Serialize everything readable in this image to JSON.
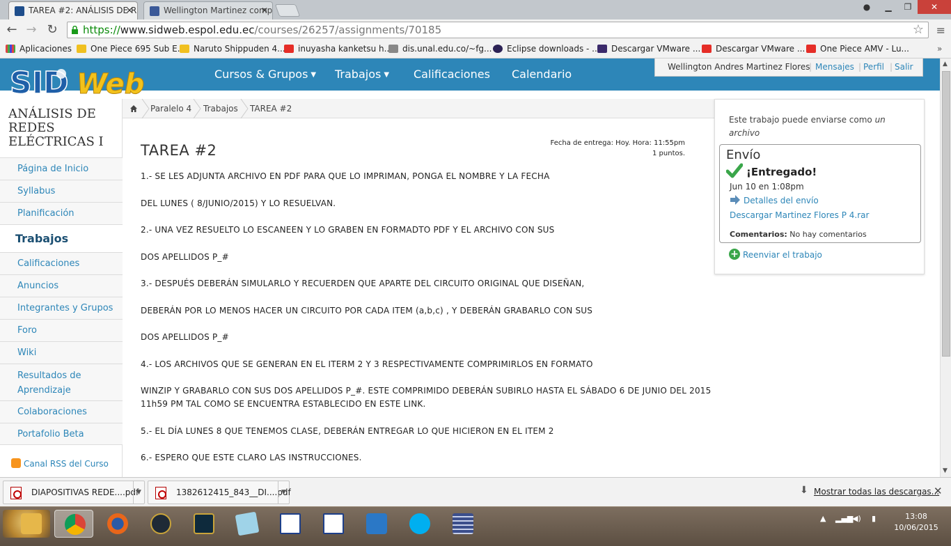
{
  "browser": {
    "tabs": [
      {
        "title": "TAREA #2: ANÁLISIS DE RE",
        "active": true
      },
      {
        "title": "Wellington Martinez comp",
        "active": false
      }
    ],
    "url": {
      "scheme": "https://",
      "host": "www.sidweb.espol.edu.ec",
      "path": "/courses/26257/assignments/70185"
    },
    "bookmarks": [
      {
        "label": "Aplicaciones",
        "icon": "apps-grid-icon"
      },
      {
        "label": "One Piece 695 Sub E...",
        "icon": "star-favicon-icon"
      },
      {
        "label": "Naruto Shippuden 4...",
        "icon": "star-favicon-icon"
      },
      {
        "label": "inuyasha kanketsu h...",
        "icon": "youtube-icon"
      },
      {
        "label": "dis.unal.edu.co/~fg...",
        "icon": "unal-icon"
      },
      {
        "label": "Eclipse downloads - ...",
        "icon": "eclipse-icon"
      },
      {
        "label": "Descargar VMware ...",
        "icon": "vmware-icon"
      },
      {
        "label": "Descargar VMware ...",
        "icon": "youtube-icon"
      },
      {
        "label": "One Piece AMV - Lu...",
        "icon": "youtube-icon"
      }
    ]
  },
  "site": {
    "logo_text": "SIDWeb",
    "nav": [
      {
        "label": "Cursos & Grupos",
        "dropdown": true
      },
      {
        "label": "Trabajos",
        "dropdown": true
      },
      {
        "label": "Calificaciones",
        "dropdown": false
      },
      {
        "label": "Calendario",
        "dropdown": false
      }
    ],
    "user": {
      "name": "Wellington Andres Martinez Flores",
      "links": [
        "Mensajes",
        "Perfil",
        "Salir"
      ]
    }
  },
  "sidebar": {
    "course_title": [
      "ANÁLISIS DE",
      "REDES",
      "ELÉCTRICAS I"
    ],
    "items": [
      {
        "label": "Página de Inicio"
      },
      {
        "label": "Syllabus"
      },
      {
        "label": "Planificación"
      },
      {
        "label": "Trabajos",
        "active": true
      },
      {
        "label": "Calificaciones"
      },
      {
        "label": "Anuncios"
      },
      {
        "label": "Integrantes y Grupos"
      },
      {
        "label": "Foro"
      },
      {
        "label": "Wiki"
      },
      {
        "label": "Resultados de Aprendizaje"
      },
      {
        "label": "Colaboraciones"
      },
      {
        "label": "Portafolio Beta"
      }
    ],
    "rss": "Canal RSS del Curso"
  },
  "breadcrumb": [
    "Paralelo 4",
    "Trabajos",
    "TAREA #2"
  ],
  "assignment": {
    "title": "TAREA #2",
    "due": "Fecha de entrega: Hoy. Hora: 11:55pm",
    "points": "1 puntos.",
    "body": [
      "1.- SE LES ADJUNTA ARCHIVO EN PDF PARA QUE LO IMPRIMAN, PONGA EL NOMBRE Y LA FECHA",
      "DEL LUNES ( 8/JUNIO/2015) Y LO RESUELVAN.",
      "2.- UNA VEZ RESUELTO LO ESCANEEN Y LO GRABEN EN FORMADTO PDF Y EL ARCHIVO CON SUS",
      "DOS APELLIDOS P_#",
      "3.- DESPUÉS DEBERÁN SIMULARLO Y RECUERDEN QUE APARTE DEL CIRCUITO ORIGINAL QUE DISEÑAN,",
      "DEBERÁN POR LO MENOS HACER UN CIRCUITO POR CADA ITEM (a,b,c) , Y DEBERÁN GRABARLO CON SUS",
      "DOS APELLIDOS P_#",
      "4.- LOS ARCHIVOS QUE SE GENERAN EN EL ITERM 2 Y 3 RESPECTIVAMENTE COMPRIMIRLOS EN FORMATO",
      "WINZIP Y GRABARLO CON SUS DOS APELLIDOS P_#. ESTE COMPRIMIDO DEBERÁN SUBIRLO HASTA EL SÁBADO 6 DE JUNIO DEL 2015",
      "11h59 PM TAL COMO SE ENCUENTRA ESTABLECIDO EN ESTE LINK.",
      "5.- EL DÍA LUNES 8 QUE TENEMOS CLASE, DEBERÁN ENTREGAR LO QUE HICIERON EN EL ITEM 2",
      "6.- ESPERO QUE ESTE CLARO LAS INSTRUCCIONES."
    ]
  },
  "submission": {
    "note_prefix": "Este trabajo puede enviarse como",
    "note_em": "un archivo",
    "heading": "Envío",
    "status": "¡Entregado!",
    "date": "Jun 10 en 1:08pm",
    "details_link": "Detalles del envío",
    "file_link": "Descargar Martinez Flores P 4.rar",
    "comments_label": "Comentarios:",
    "comments_value": "No hay comentarios",
    "resend": "Reenviar el trabajo"
  },
  "downloads": {
    "items": [
      "DIAPOSITIVAS REDE....pdf",
      "1382612415_843__DI....pdf"
    ],
    "show_all": "Mostrar todas las descargas..."
  },
  "taskbar": {
    "time": "13:08",
    "date": "10/06/2015",
    "apps": [
      "explorer",
      "chrome",
      "firefox",
      "warcraft",
      "league",
      "notepad",
      "paint",
      "calculator",
      "runner",
      "skype",
      "equalizer"
    ]
  },
  "colors": {
    "brand": "#2d86b8",
    "link": "#2d86b8",
    "check": "#3aa64a"
  }
}
